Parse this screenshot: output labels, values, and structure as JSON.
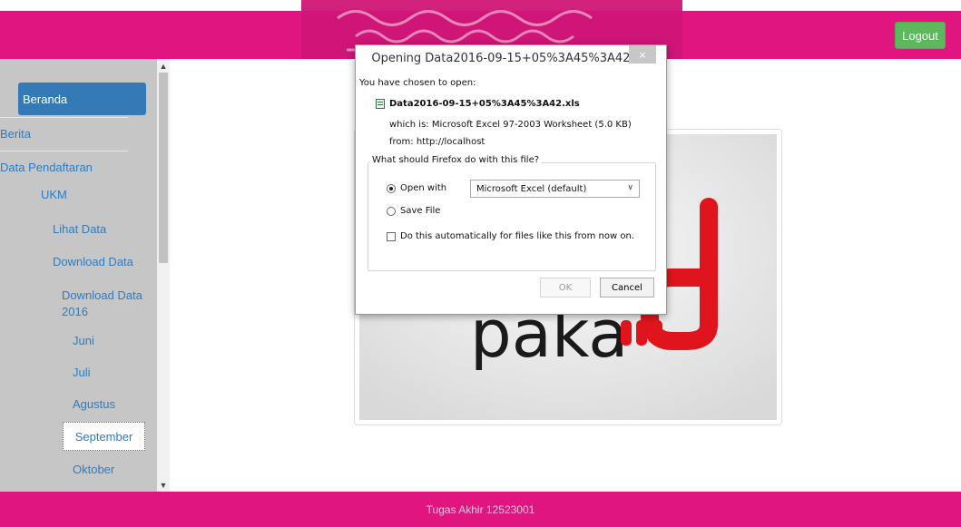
{
  "header": {
    "logout_label": "Logout"
  },
  "sidebar": {
    "items": [
      {
        "label": "Beranda"
      },
      {
        "label": "Berita"
      },
      {
        "label": "Data Pendaftaran"
      },
      {
        "label": "UKM"
      },
      {
        "label": "Lihat Data"
      },
      {
        "label": "Download Data"
      },
      {
        "label": "Download Data 2016"
      },
      {
        "label": "Juni"
      },
      {
        "label": "Juli"
      },
      {
        "label": "Agustus"
      },
      {
        "label": "September"
      },
      {
        "label": "Oktober"
      }
    ]
  },
  "dialog": {
    "title": "Opening Data2016-09-15+05%3A45%3A42.xls",
    "close_label": "×",
    "intro": "You have chosen to open:",
    "filename": "Data2016-09-15+05%3A45%3A42.xls",
    "which_is": "which is:  Microsoft Excel 97-2003 Worksheet (5.0 KB)",
    "from": "from:  http://localhost",
    "question": "What should Firefox do with this file?",
    "open_with_label": "Open with",
    "open_with_value": "Microsoft Excel (default)",
    "save_file_label": "Save File",
    "auto_label": "Do this automatically for files like this from now on.",
    "ok_label": "OK",
    "cancel_label": "Cancel"
  },
  "image_text": "paka",
  "footer": {
    "text": "Tugas Akhir 12523001"
  },
  "colors": {
    "brand": "#e0157f",
    "active_nav": "#337ab7",
    "logout": "#5cb85c"
  }
}
